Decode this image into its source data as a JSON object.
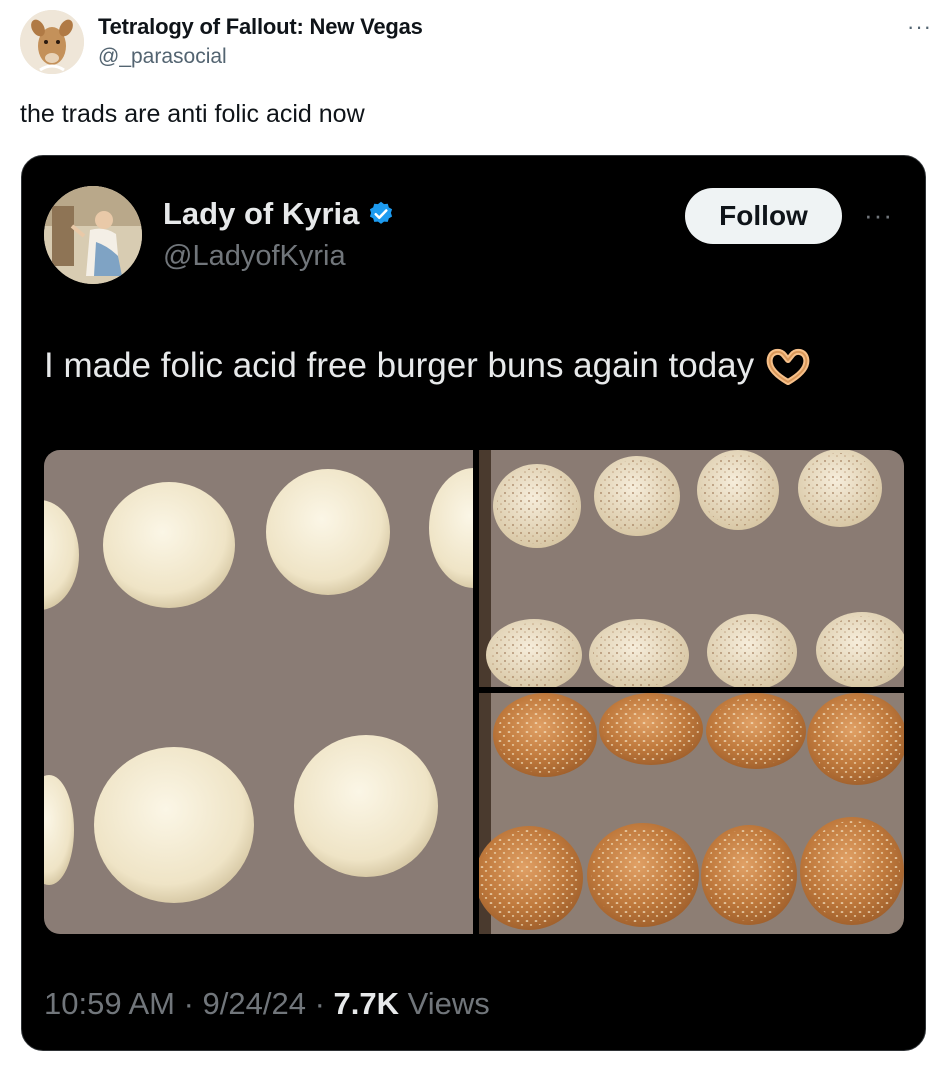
{
  "outer_tweet": {
    "author_name": "Tetralogy of Fallout: New Vegas",
    "author_handle": "@_parasocial",
    "more_label": "···",
    "text": "the trads are anti folic acid now",
    "avatar_icon": "deer-avatar-icon"
  },
  "quoted_tweet": {
    "author_name": "Lady of Kyria",
    "author_handle": "@LadyofKyria",
    "verified": true,
    "follow_label": "Follow",
    "more_label": "···",
    "text": "I made folic acid free burger buns again today",
    "emoji_icon": "heart-hands-icon",
    "timestamp": "10:59 AM · 9/24/24 · ",
    "views_count": "7.7K",
    "views_label": " Views",
    "photos": [
      {
        "description_icon": "raw-dough-buns-photo"
      },
      {
        "description_icon": "seeded-dough-buns-photo"
      },
      {
        "description_icon": "baked-sesame-buns-photo"
      }
    ]
  },
  "colors": {
    "accent_blue": "#1d9bf0",
    "card_bg": "#000000",
    "muted_text": "#71767b"
  }
}
